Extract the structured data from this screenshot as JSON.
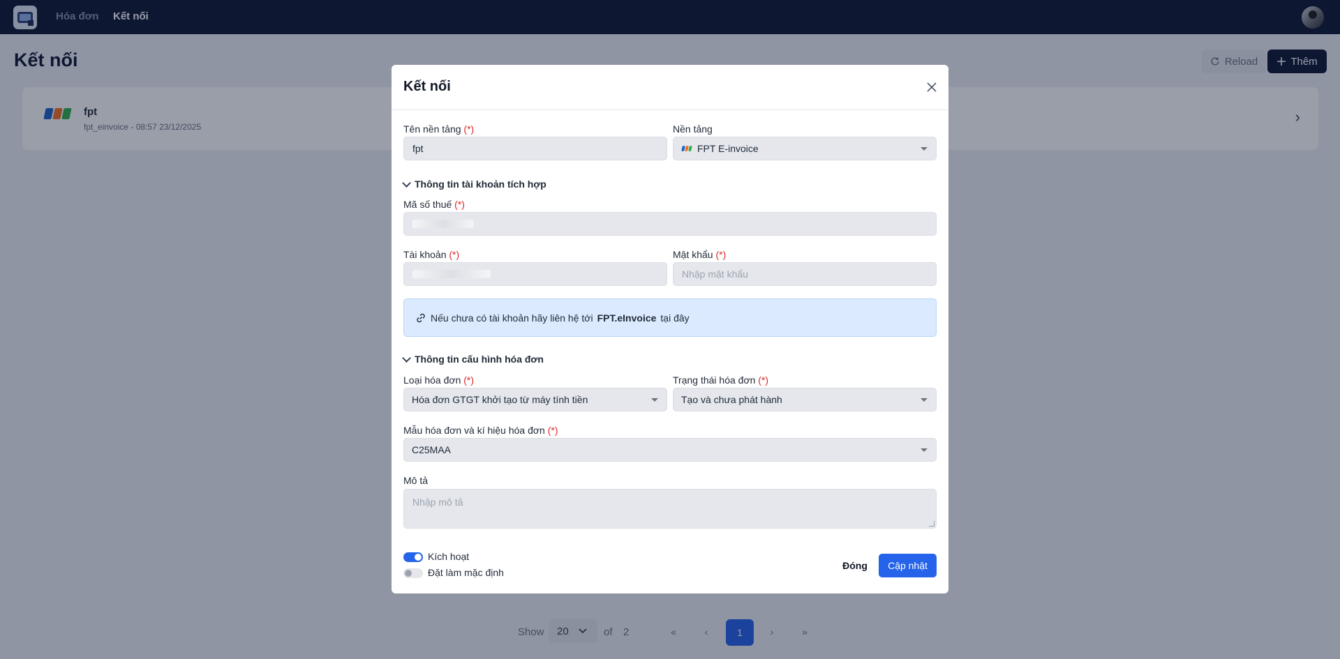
{
  "nav": {
    "items": [
      {
        "label": "Hóa đơn"
      },
      {
        "label": "Kết nối"
      }
    ]
  },
  "page": {
    "title": "Kết nối",
    "reload_label": "Reload",
    "add_label": "Thêm"
  },
  "connections": [
    {
      "name": "fpt",
      "subtitle": "fpt_einvoice - 08:57 23/12/2025"
    }
  ],
  "pagination": {
    "show_label": "Show",
    "page_size": "20",
    "of_label": "of",
    "total_pages": "2",
    "current_page": "1",
    "first": "«",
    "prev": "‹",
    "next": "›",
    "last": "»"
  },
  "modal": {
    "title": "Kết nối",
    "required_mark": "(*)",
    "platform_name_label": "Tên nền tảng",
    "platform_name_value": "fpt",
    "platform_label": "Nền tảng",
    "platform_value": "FPT E-invoice",
    "account_section": "Thông tin tài khoản tích hợp",
    "tax_code_label": "Mã số thuế",
    "account_label": "Tài khoản",
    "password_label": "Mật khẩu",
    "password_placeholder": "Nhập mật khẩu",
    "info_text_before": "Nếu chưa có tài khoản hãy liên hệ tới",
    "info_brand": "FPT.eInvoice",
    "info_text_after": "tại đây",
    "invoice_section": "Thông tin cấu hình hóa đơn",
    "invoice_type_label": "Loại hóa đơn",
    "invoice_type_value": "Hóa đơn GTGT khởi tạo từ máy tính tiền",
    "invoice_status_label": "Trạng thái hóa đơn",
    "invoice_status_value": "Tạo và chưa phát hành",
    "template_label": "Mẫu hóa đơn và kí hiệu hóa đơn",
    "template_value": "C25MAA",
    "description_label": "Mô tả",
    "description_placeholder": "Nhập mô tả",
    "active_label": "Kích hoạt",
    "active": true,
    "default_label": "Đặt làm mặc định",
    "default": false,
    "close_label": "Đóng",
    "update_label": "Cập nhật"
  },
  "colors": {
    "primary": "#2563eb",
    "navbar": "#0f1833",
    "required": "#dc2626",
    "info_bg": "#dbeafe"
  },
  "icons": {
    "reload": "reload-icon",
    "add": "plus-icon",
    "close": "close-icon",
    "link": "link-icon",
    "chevron": "chevron-down-icon"
  }
}
